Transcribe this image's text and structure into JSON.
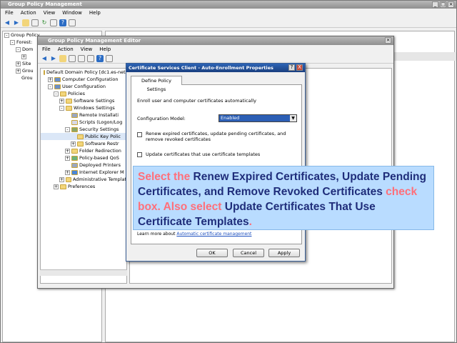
{
  "gpm": {
    "title": "Group Policy Management",
    "menu": [
      "File",
      "Action",
      "View",
      "Window",
      "Help"
    ],
    "tree": [
      "Group Policy",
      "Forest:",
      "Dom",
      "Site",
      "Grou",
      "Grou"
    ]
  },
  "gpme": {
    "title": "Group Policy Management Editor",
    "menu": [
      "File",
      "Action",
      "View",
      "Help"
    ],
    "tree": [
      {
        "label": "Default Domain Policy [dc1.es-net.",
        "indent": 0,
        "exp": "",
        "icon": "doc"
      },
      {
        "label": "Computer Configuration",
        "indent": 1,
        "exp": "+",
        "icon": "pc"
      },
      {
        "label": "User Configuration",
        "indent": 1,
        "exp": "-",
        "icon": "user"
      },
      {
        "label": "Policies",
        "indent": 2,
        "exp": "-",
        "icon": "folder"
      },
      {
        "label": "Software Settings",
        "indent": 3,
        "exp": "+",
        "icon": "folder"
      },
      {
        "label": "Windows Settings",
        "indent": 3,
        "exp": "-",
        "icon": "folder"
      },
      {
        "label": "Remote Installati",
        "indent": 4,
        "exp": "",
        "icon": "gear"
      },
      {
        "label": "Scripts (Logon/Log",
        "indent": 4,
        "exp": "",
        "icon": "script"
      },
      {
        "label": "Security Settings",
        "indent": 4,
        "exp": "-",
        "icon": "lock"
      },
      {
        "label": "Public Key Polic",
        "indent": 5,
        "exp": "",
        "icon": "folder"
      },
      {
        "label": "Software Restr",
        "indent": 5,
        "exp": "+",
        "icon": "folder"
      },
      {
        "label": "Folder Redirection",
        "indent": 4,
        "exp": "+",
        "icon": "folder"
      },
      {
        "label": "Policy-based QoS",
        "indent": 4,
        "exp": "+",
        "icon": "chart"
      },
      {
        "label": "Deployed Printers",
        "indent": 4,
        "exp": "",
        "icon": "printer"
      },
      {
        "label": "Internet Explorer M",
        "indent": 4,
        "exp": "+",
        "icon": "ie"
      },
      {
        "label": "Administrative Templat",
        "indent": 3,
        "exp": "+",
        "icon": "folder"
      },
      {
        "label": "Preferences",
        "indent": 2,
        "exp": "+",
        "icon": "folder"
      }
    ]
  },
  "dialog": {
    "title": "Certificate Services Client - Auto-Enrollment Properties",
    "help": "?",
    "close": "X",
    "tab": "Define Policy Settings",
    "intro": "Enroll user and computer certificates automatically",
    "config_label": "Configuration Model:",
    "config_value": "Enabled",
    "cb1": "Renew expired certificates, update pending certificates, and remove revoked certificates",
    "cb2": "Update certificates that use certificate templates",
    "link_prefix": "Learn more about",
    "link": "Automatic certificate management",
    "ok": "OK",
    "cancel": "Cancel",
    "apply": "Apply"
  },
  "callout": {
    "p1": "Select the",
    "p2": " Renew Expired Certificates, Update Pending Certificates, and Remove Revoked Certificates ",
    "p3": "check box. Also select",
    "p4": " Update Certificates That Use Certificate Templates",
    "p5": "."
  },
  "colors": {
    "accent": "#ff6f7a",
    "callout_bg": "#b9dcff",
    "callout_text": "#1f2d7a",
    "title_active": "#1a3f80"
  }
}
